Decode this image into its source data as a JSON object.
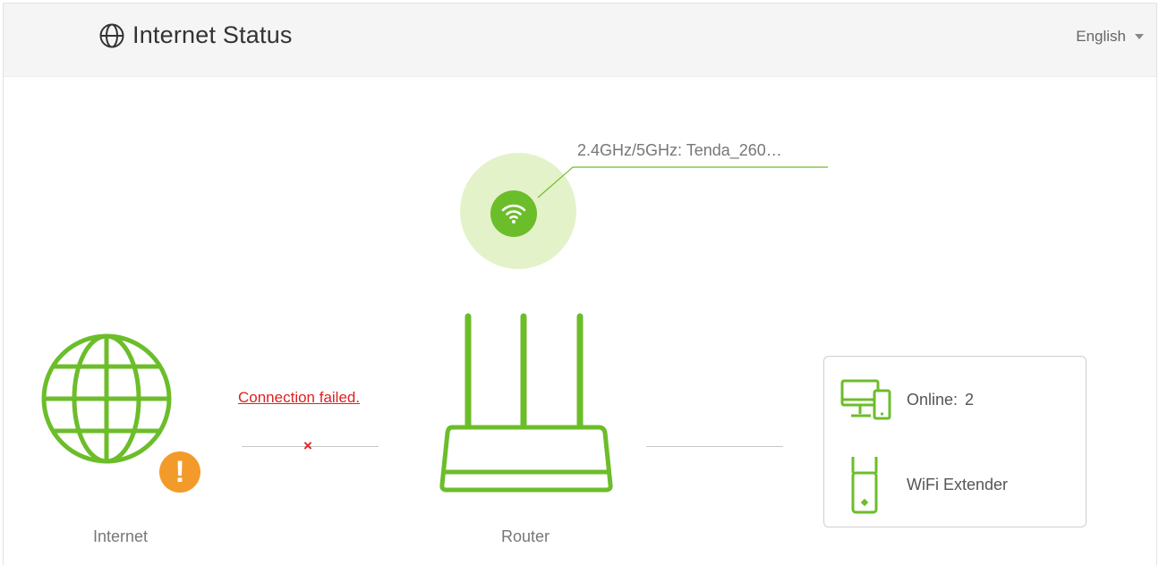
{
  "header": {
    "title": "Internet Status",
    "language": "English"
  },
  "wifi": {
    "ssid_text": "2.4GHz/5GHz: Tenda_260…"
  },
  "internet": {
    "label": "Internet",
    "status_link": "Connection failed.",
    "status_mark": "×",
    "warning_symbol": "!"
  },
  "router": {
    "label": "Router"
  },
  "clients": {
    "online_label": "Online:",
    "online_count": "2",
    "extender_label": "WiFi Extender"
  },
  "colors": {
    "accent_green": "#6cbd2a",
    "light_green": "#e3f2c8",
    "warning_orange": "#f29b2a",
    "error_red": "#e02020"
  }
}
